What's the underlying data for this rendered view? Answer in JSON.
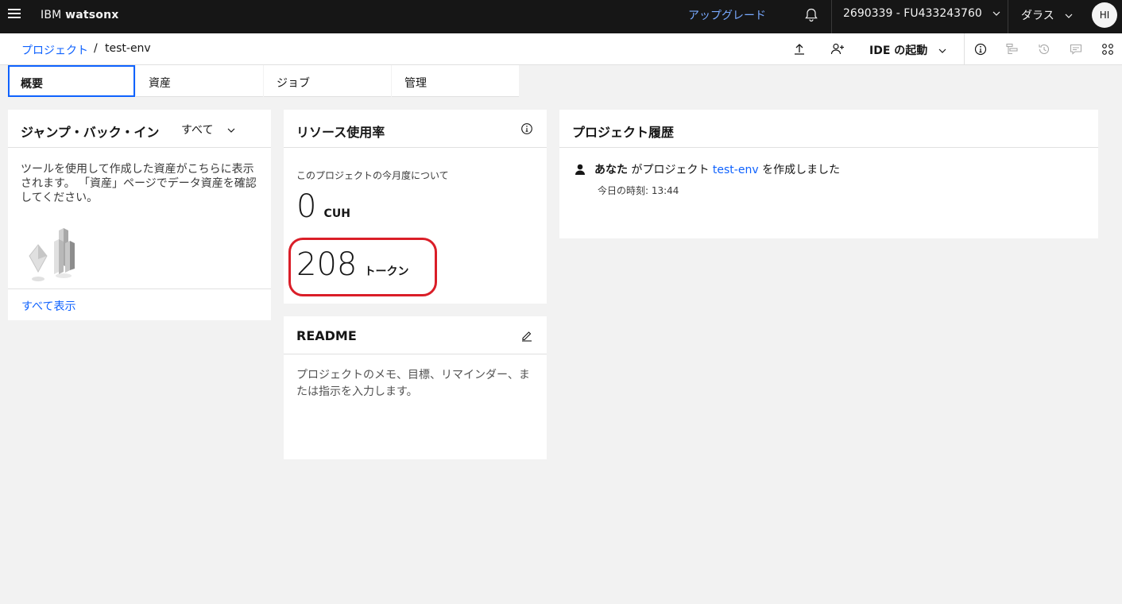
{
  "header": {
    "brand_prefix": "IBM",
    "brand_name": "watsonx",
    "upgrade_label": "アップグレード",
    "account_label": "2690339 - FU433243760",
    "region_label": "ダラス",
    "avatar_initials": "HI"
  },
  "breadcrumb": {
    "root": "プロジェクト",
    "separator": "/",
    "current": "test-env"
  },
  "toolbar": {
    "ide_label": "IDE の起動"
  },
  "tabs": [
    {
      "label": "概要",
      "active": true
    },
    {
      "label": "資産",
      "active": false
    },
    {
      "label": "ジョブ",
      "active": false
    },
    {
      "label": "管理",
      "active": false
    }
  ],
  "jump_back": {
    "title": "ジャンプ・バック・イン",
    "filter_label": "すべて",
    "description": "ツールを使用して作成した資産がこちらに表示されます。 「資産」ページでデータ資産を確認してください。",
    "view_all": "すべて表示"
  },
  "resource_usage": {
    "title": "リソース使用率",
    "period": "このプロジェクトの今月度について",
    "cuh_value": "0",
    "cuh_unit": "CUH",
    "token_value": "208",
    "token_unit": "トークン",
    "highlight_color": "#da1e28"
  },
  "readme": {
    "title": "README",
    "placeholder": "プロジェクトのメモ、目標、リマインダー、または指示を入力します。"
  },
  "history": {
    "title": "プロジェクト履歴",
    "entries": [
      {
        "actor": "あなた",
        "text_before": "がプロジェクト",
        "project": "test-env",
        "text_after": "を作成しました",
        "time": "今日の時刻: 13:44"
      }
    ]
  },
  "colors": {
    "accent": "#0f62fe",
    "header_bg": "#161616",
    "link_dark": "#78a9ff"
  }
}
